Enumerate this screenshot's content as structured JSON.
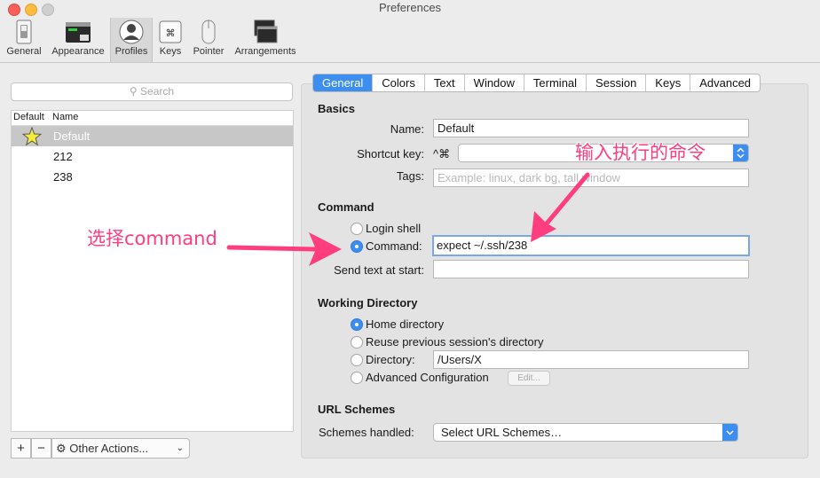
{
  "window": {
    "title": "Preferences"
  },
  "toolbar": {
    "items": [
      {
        "label": "General",
        "icon": "switch-icon"
      },
      {
        "label": "Appearance",
        "icon": "appearance-icon"
      },
      {
        "label": "Profiles",
        "icon": "profile-icon"
      },
      {
        "label": "Keys",
        "icon": "command-key-icon"
      },
      {
        "label": "Pointer",
        "icon": "mouse-icon"
      },
      {
        "label": "Arrangements",
        "icon": "windows-icon"
      }
    ],
    "active": "Profiles"
  },
  "profiles": {
    "search_placeholder": "Search",
    "col_default": "Default",
    "col_name": "Name",
    "rows": [
      {
        "name": "Default",
        "is_default": true,
        "selected": true
      },
      {
        "name": "212",
        "is_default": false,
        "selected": false
      },
      {
        "name": "238",
        "is_default": false,
        "selected": false
      }
    ],
    "add_label": "+",
    "remove_label": "−",
    "other_actions_label": "Other Actions..."
  },
  "tabs": {
    "items": [
      "General",
      "Colors",
      "Text",
      "Window",
      "Terminal",
      "Session",
      "Keys",
      "Advanced"
    ],
    "active": "General"
  },
  "basics": {
    "heading": "Basics",
    "name_label": "Name:",
    "name_value": "Default",
    "shortcut_label": "Shortcut key:",
    "shortcut_prefix": "^⌘",
    "tags_label": "Tags:",
    "tags_placeholder": "Example: linux, dark bg, tall window"
  },
  "command": {
    "heading": "Command",
    "login_shell_label": "Login shell",
    "command_label": "Command:",
    "command_value": "expect ~/.ssh/238",
    "selected": "command",
    "send_text_label": "Send text at start:",
    "send_text_value": ""
  },
  "working_directory": {
    "heading": "Working Directory",
    "options": [
      "Home directory",
      "Reuse previous session's directory",
      "Directory:",
      "Advanced Configuration"
    ],
    "selected": "Home directory",
    "directory_value": "/Users/X",
    "edit_label": "Edit..."
  },
  "url_schemes": {
    "heading": "URL Schemes",
    "label": "Schemes handled:",
    "select_value": "Select URL Schemes…"
  },
  "annotations": {
    "select_command": "选择command",
    "enter_command": "输入执行的命令"
  },
  "colors": {
    "accent": "#3c8ff0",
    "annotation": "#ff3d7f"
  }
}
